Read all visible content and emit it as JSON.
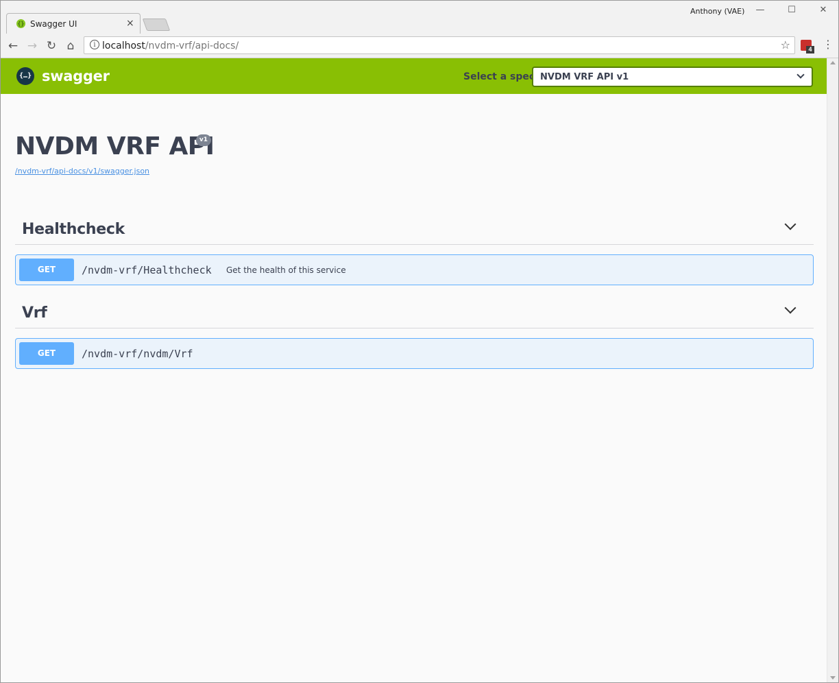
{
  "browser": {
    "tab_title": "Swagger UI",
    "tab_close": "×",
    "profile_name": "Anthony (VAE)",
    "url_host": "localhost",
    "url_path": "/nvdm-vrf/api-docs/",
    "extension_badge": "4",
    "window_controls": {
      "minimize": "—",
      "maximize": "☐",
      "close": "✕"
    },
    "icons": {
      "back": "←",
      "forward": "→",
      "reload": "↻",
      "home": "⌂",
      "info": "i",
      "star": "☆",
      "menu": "⋮"
    }
  },
  "topbar": {
    "logo_glyph": "{…}",
    "logo_text": "swagger",
    "select_label": "Select a spec",
    "select_value": "NVDM VRF API v1",
    "brand_color": "#89bf04"
  },
  "info": {
    "title": "NVDM VRF API",
    "version": "v1",
    "spec_url": "/nvdm-vrf/api-docs/v1/swagger.json"
  },
  "tags": [
    {
      "name": "Healthcheck",
      "operations": [
        {
          "method": "GET",
          "path": "/nvdm-vrf/Healthcheck",
          "summary": "Get the health of this service"
        }
      ]
    },
    {
      "name": "Vrf",
      "operations": [
        {
          "method": "GET",
          "path": "/nvdm-vrf/nvdm/Vrf",
          "summary": ""
        }
      ]
    }
  ],
  "colors": {
    "get_method": "#61affe",
    "get_background": "#ebf3fb",
    "text": "#3b4151"
  }
}
